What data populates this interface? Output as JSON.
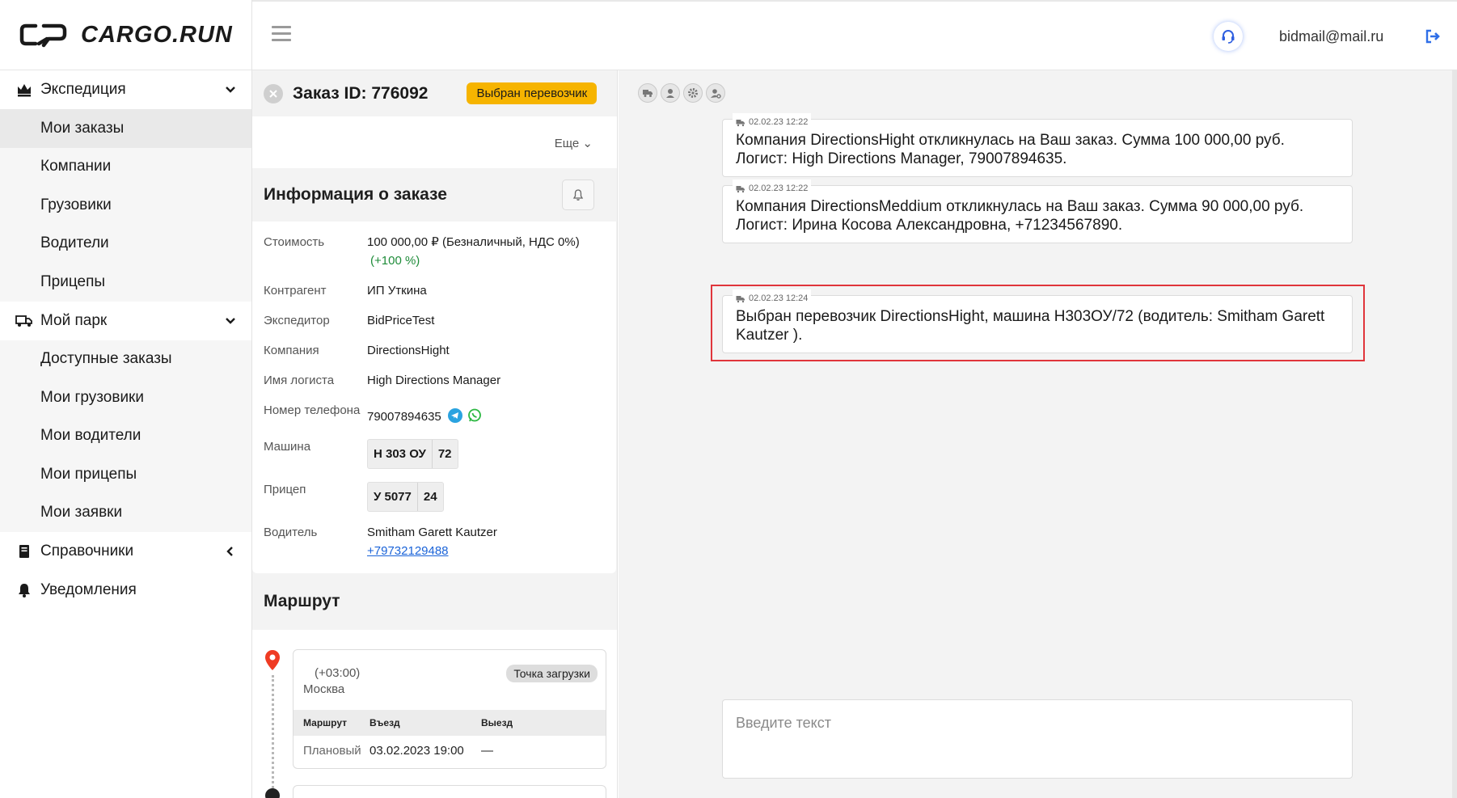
{
  "app": {
    "brand": "CARGO.RUN"
  },
  "header": {
    "email": "bidmail@mail.ru"
  },
  "sidebar": {
    "groups": [
      {
        "label": "Экспедиция",
        "items": [
          "Мои заказы",
          "Компании",
          "Грузовики",
          "Водители",
          "Прицепы"
        ],
        "active": "Мои заказы"
      },
      {
        "label": "Мой парк",
        "items": [
          "Доступные заказы",
          "Мои грузовики",
          "Мои водители",
          "Мои прицепы",
          "Мои заявки"
        ]
      },
      {
        "label": "Справочники"
      },
      {
        "label": "Уведомления"
      }
    ]
  },
  "order": {
    "title": "Заказ ID: 776092",
    "status": "Выбран перевозчик",
    "more_label": "Еще",
    "info_title": "Информация о заказе",
    "fields": {
      "cost_label": "Стоимость",
      "cost_value": "100 000,00 ₽ (Безналичный, НДС 0%)",
      "cost_delta": "(+100 %)",
      "contractor_label": "Контрагент",
      "contractor_value": "ИП Уткина",
      "forwarder_label": "Экспедитор",
      "forwarder_value": "BidPriceTest",
      "company_label": "Компания",
      "company_value": "DirectionsHight",
      "logist_label": "Имя логиста",
      "logist_value": "High Directions Manager",
      "phone_label": "Номер телефона",
      "phone_value": "79007894635",
      "car_label": "Машина",
      "car_plate": "Н 303 ОУ",
      "car_region": "72",
      "trailer_label": "Прицеп",
      "trailer_plate": "У 5077",
      "trailer_region": "24",
      "driver_label": "Водитель",
      "driver_name": "Smitham Garett Kautzer",
      "driver_phone": "+79732129488"
    },
    "route": {
      "title": "Маршрут",
      "timezone": "(+03:00)",
      "city": "Москва",
      "badge": "Точка загрузки",
      "columns": [
        "Маршрут",
        "Въезд",
        "Выезд"
      ],
      "row": [
        "Плановый",
        "03.02.2023 19:00",
        "—"
      ]
    }
  },
  "chat": {
    "messages": [
      {
        "time": "02.02.23 12:22",
        "text": "Компания DirectionsHight откликнулась на Ваш заказ. Сумма 100 000,00 руб. Логист: High Directions Manager, 79007894635."
      },
      {
        "time": "02.02.23 12:22",
        "text": "Компания DirectionsMeddium откликнулась на Ваш заказ. Сумма 90 000,00 руб. Логист: Ирина Косова Александровна, +71234567890."
      },
      {
        "time": "02.02.23 12:24",
        "text": "Выбран перевозчик DirectionsHight, машина Н303ОУ/72 (водитель:  Smitham Garett Kautzer )."
      }
    ],
    "placeholder": "Введите текст"
  },
  "colors": {
    "status_badge": "#f6b400",
    "highlight": "#e0353b",
    "link": "#1a63d8"
  },
  "icons": [
    "crown-icon",
    "truck-icon",
    "book-icon",
    "bell-icon",
    "headset-icon",
    "logout-icon",
    "telegram-icon",
    "whatsapp-icon"
  ]
}
